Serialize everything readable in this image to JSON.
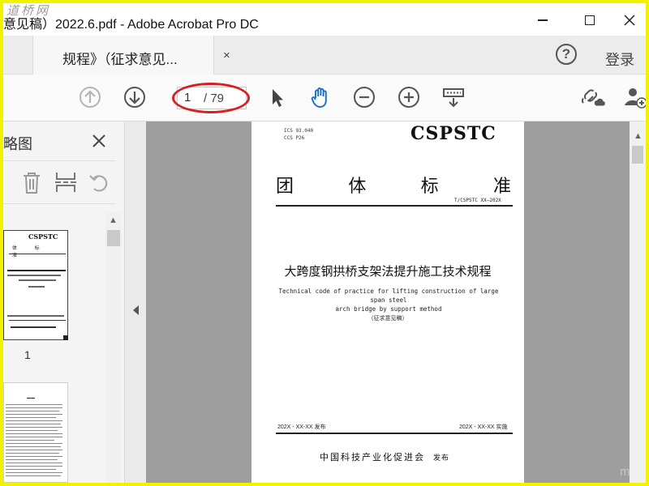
{
  "window": {
    "title": "意见稿）2022.6.pdf - Adobe Acrobat Pro DC",
    "watermark_top": "道桥网",
    "watermark_bottom": "m"
  },
  "tab": {
    "label": "规程》（征求意见...",
    "close": "×"
  },
  "header": {
    "help": "?",
    "login": "登录"
  },
  "toolbar": {
    "page_current": "1",
    "page_total": "/ 79",
    "icons": [
      "arrow-up-icon",
      "arrow-down-icon",
      "select-pointer-icon",
      "hand-tool-icon",
      "zoom-out-icon",
      "zoom-in-icon",
      "page-display-icon",
      "share-link-icon",
      "add-user-icon"
    ],
    "annotation_color": "#d42020",
    "accent": "#1a6fc4"
  },
  "left_panel": {
    "title": "缩略图",
    "tools": [
      "trash-icon",
      "extract-icon",
      "rotate-icon"
    ],
    "thumbnail": {
      "page_number": "1",
      "header": "CSPSTC",
      "title_chars": "体 标 准"
    }
  },
  "document": {
    "ics_line1": "ICS 93.040",
    "ics_line2": "CCS P26",
    "org": "CSPSTC",
    "standard_type": [
      "团",
      "体",
      "标",
      "准"
    ],
    "standard_no": "T/CSPSTC XX—202X",
    "title_cn": "大跨度钢拱桥支架法提升施工技术规程",
    "title_en_line1": "Technical code of practice for lifting construction of large span steel",
    "title_en_line2": "arch bridge by support method",
    "draft_note": "（征求意见稿）",
    "pub_date": "202X - XX-XX 发布",
    "imp_date": "202X - XX-XX 实施",
    "publisher": "中国科技产业化促进会",
    "publish_word": "发布"
  }
}
